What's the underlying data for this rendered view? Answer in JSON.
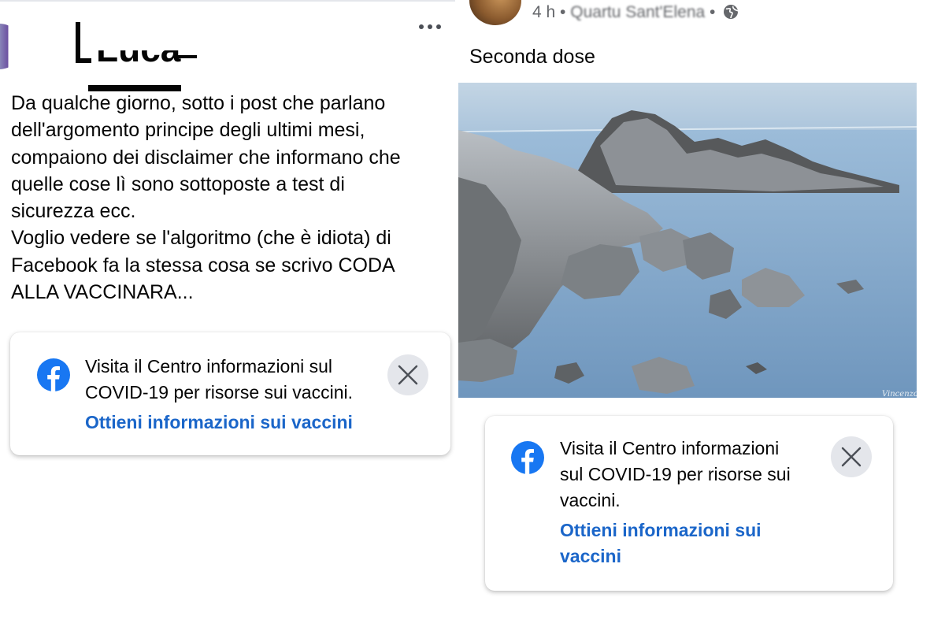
{
  "left_post": {
    "author_name": "Luca",
    "body": "Da qualche giorno, sotto i post che parlano\ndell'argomento principe degli ultimi mesi,\ncompaiono dei disclaimer che informano che\nquelle cose lì sono sottoposte a test di\nsicurezza ecc.\nVoglio vedere se l'algoritmo (che è idiota) di\nFacebook fa la stessa cosa se scrivo CODA\nALLA VACCINARA...",
    "more_icon": "more-horizontal-icon"
  },
  "left_card": {
    "text_line1": "Visita il Centro informazioni sul",
    "text_line2": "COVID-19 per risorse sui vaccini.",
    "link": "Ottieni informazioni sui vaccini",
    "icon": "facebook-icon",
    "close_icon": "close-icon"
  },
  "right_post": {
    "time": "4 h",
    "separator": "•",
    "location": "Quartu Sant'Elena",
    "visibility_icon": "globe-icon",
    "title": "Seconda dose",
    "photo_watermark": "Vincenzo Ro"
  },
  "right_card": {
    "text_line1": "Visita il Centro informazioni",
    "text_line2": "sul COVID-19 per risorse sui",
    "text_line3": "vaccini.",
    "link_line1": "Ottieni informazioni sui",
    "link_line2": "vaccini",
    "icon": "facebook-icon",
    "close_icon": "close-icon"
  },
  "colors": {
    "facebook_blue": "#1877f2",
    "link_blue": "#1b66c9",
    "close_bg": "#e4e6eb",
    "text": "#050505",
    "meta": "#65676b"
  }
}
